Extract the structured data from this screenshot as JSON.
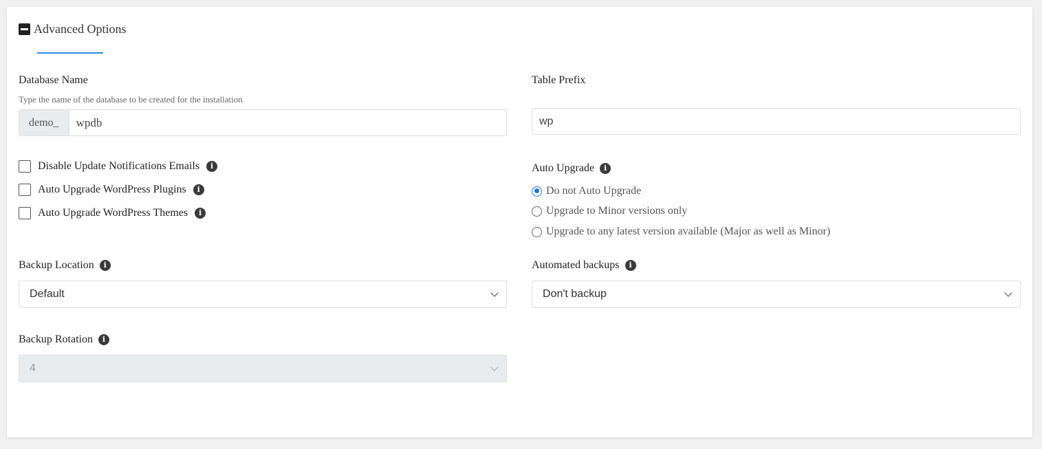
{
  "header": {
    "title": "Advanced Options"
  },
  "database": {
    "label": "Database Name",
    "hint": "Type the name of the database to be created for the installation",
    "prefix": "demo_",
    "value": "wpdb"
  },
  "table_prefix": {
    "label": "Table Prefix",
    "value": "wp"
  },
  "checkboxes": [
    {
      "label": "Disable Update Notifications Emails",
      "checked": false
    },
    {
      "label": "Auto Upgrade WordPress Plugins",
      "checked": false
    },
    {
      "label": "Auto Upgrade WordPress Themes",
      "checked": false
    }
  ],
  "auto_upgrade": {
    "label": "Auto Upgrade",
    "options": [
      {
        "label": "Do not Auto Upgrade",
        "selected": true
      },
      {
        "label": "Upgrade to Minor versions only",
        "selected": false
      },
      {
        "label": "Upgrade to any latest version available (Major as well as Minor)",
        "selected": false
      }
    ]
  },
  "backup_location": {
    "label": "Backup Location",
    "value": "Default"
  },
  "automated_backups": {
    "label": "Automated backups",
    "value": "Don't backup"
  },
  "backup_rotation": {
    "label": "Backup Rotation",
    "value": "4",
    "disabled": true
  },
  "icons": {
    "info": "i"
  },
  "colors": {
    "accent": "#1a73e8",
    "tab_underline": "#2b8de0",
    "disabled_bg": "#e9ecef"
  }
}
